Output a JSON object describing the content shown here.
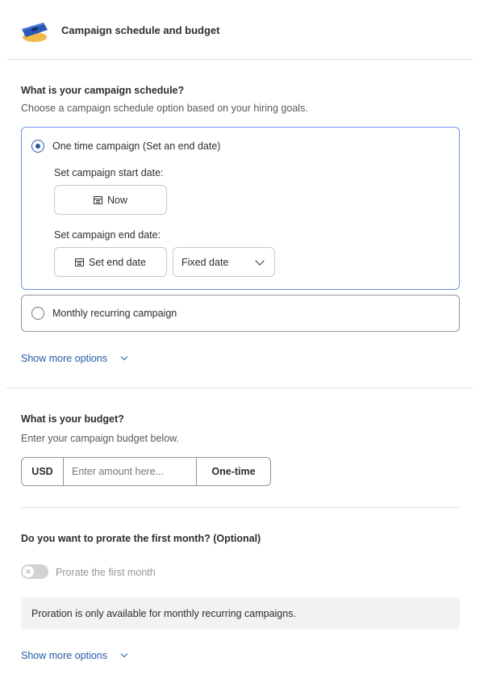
{
  "header": {
    "title": "Campaign schedule and budget",
    "icon": "campaign-ticket-icon"
  },
  "schedule": {
    "title": "What is your campaign schedule?",
    "subtitle": "Choose a campaign schedule option based on your hiring goals.",
    "options": [
      {
        "label": "One time campaign (Set an end date)",
        "selected": true,
        "start_label": "Set campaign start date:",
        "start_button": "Now",
        "end_label": "Set campaign end date:",
        "end_button": "Set end date",
        "end_type": "Fixed date"
      },
      {
        "label": "Monthly recurring campaign",
        "selected": false
      }
    ],
    "more_options": "Show more options"
  },
  "budget": {
    "title": "What is your budget?",
    "subtitle": "Enter your campaign budget below.",
    "currency": "USD",
    "amount_placeholder": "Enter amount here...",
    "amount_value": "",
    "frequency": "One-time"
  },
  "prorate": {
    "title": "Do you want to prorate the first month? (Optional)",
    "toggle_label": "Prorate the first month",
    "toggle_on": false,
    "info": "Proration is only available for monthly recurring campaigns.",
    "more_options": "Show more options"
  },
  "colors": {
    "accent": "#2557a7",
    "selected_border": "#6f93e6",
    "divider": "#e4e2e0",
    "info_bg": "#f3f2f1"
  }
}
